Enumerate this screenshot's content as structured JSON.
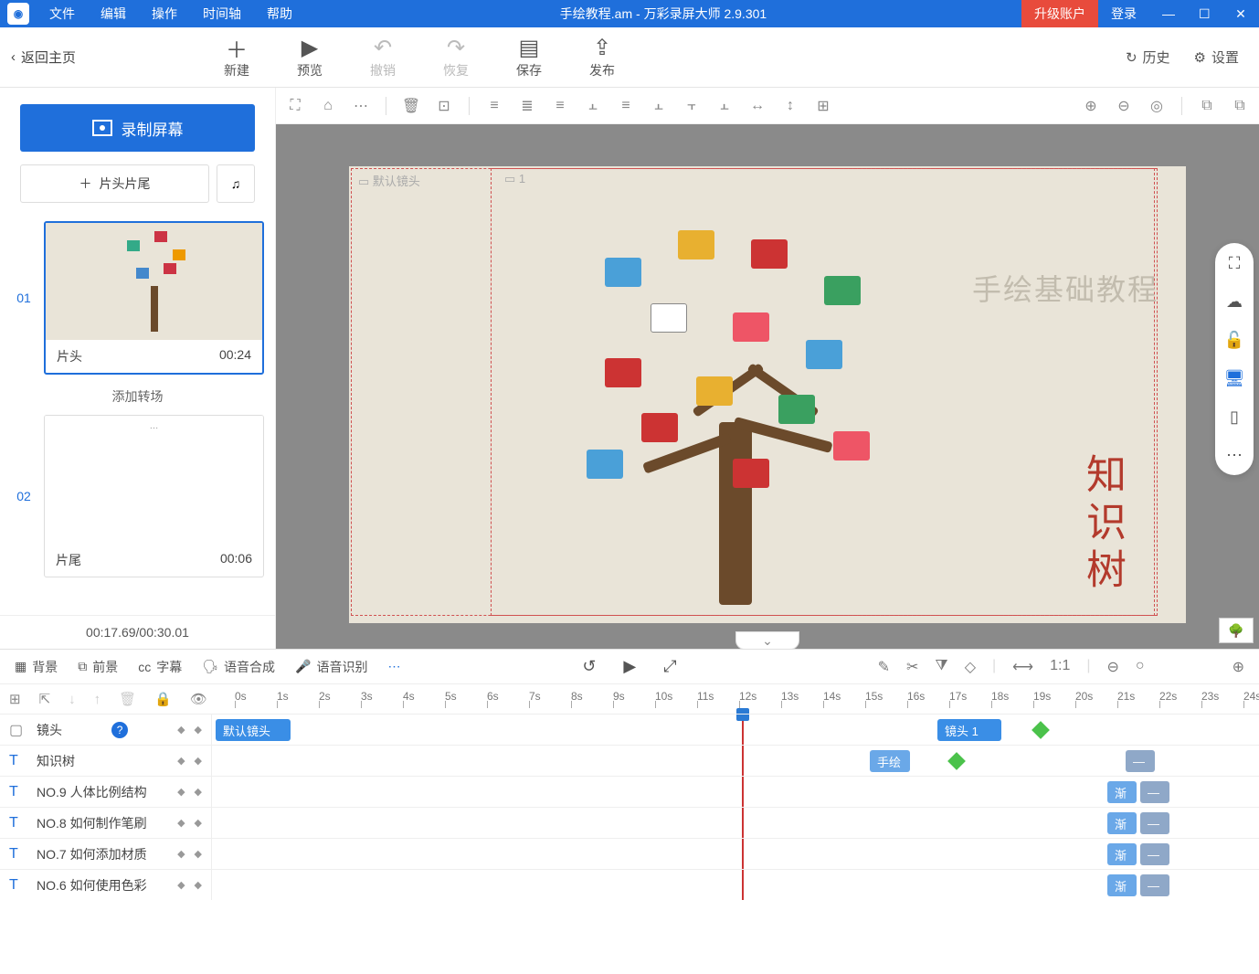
{
  "titlebar": {
    "menus": [
      "文件",
      "编辑",
      "操作",
      "时间轴",
      "帮助"
    ],
    "title": "手绘教程.am - 万彩录屏大师 2.9.301",
    "upgrade": "升级账户",
    "login": "登录"
  },
  "maintoolbar": {
    "back": "返回主页",
    "buttons": [
      {
        "label": "新建",
        "icon": "＋",
        "disabled": false
      },
      {
        "label": "预览",
        "icon": "▶",
        "disabled": false
      },
      {
        "label": "撤销",
        "icon": "↶",
        "disabled": true
      },
      {
        "label": "恢复",
        "icon": "↷",
        "disabled": true
      },
      {
        "label": "保存",
        "icon": "▤",
        "disabled": false
      },
      {
        "label": "发布",
        "icon": "⇪",
        "disabled": false
      }
    ],
    "history": "历史",
    "settings": "设置"
  },
  "leftpanel": {
    "record": "录制屏幕",
    "intro": "片头片尾",
    "slides": [
      {
        "num": "01",
        "name": "片头",
        "time": "00:24",
        "active": true
      },
      {
        "num": "02",
        "name": "片尾",
        "time": "00:06",
        "active": false
      }
    ],
    "addTransition": "添加转场",
    "timeStatus": "00:17.69/00:30.01"
  },
  "canvas": {
    "ruler1": "默认镜头",
    "ruler2": "1",
    "watermark": "手绘基础教程",
    "verticalText": "知识树"
  },
  "timeline": {
    "tabs": [
      "背景",
      "前景",
      "字幕",
      "语音合成",
      "语音识别"
    ],
    "ticks": [
      "0s",
      "1s",
      "2s",
      "3s",
      "4s",
      "5s",
      "6s",
      "7s",
      "8s",
      "9s",
      "10s",
      "11s",
      "12s",
      "13s",
      "14s",
      "15s",
      "16s",
      "17s",
      "18s",
      "19s",
      "20s",
      "21s",
      "22s",
      "23s",
      "24s"
    ],
    "tracks": {
      "camera": {
        "label": "镜头",
        "clip1": "默认镜头",
        "clip2": "镜头 1"
      },
      "rows": [
        {
          "label": "知识树",
          "tag": "手绘"
        },
        {
          "label": "NO.9  人体比例结构",
          "tag": "渐"
        },
        {
          "label": "NO.8  如何制作笔刷",
          "tag": "渐"
        },
        {
          "label": "NO.7  如何添加材质",
          "tag": "渐"
        },
        {
          "label": "NO.6  如何使用色彩",
          "tag": "渐"
        }
      ]
    }
  }
}
